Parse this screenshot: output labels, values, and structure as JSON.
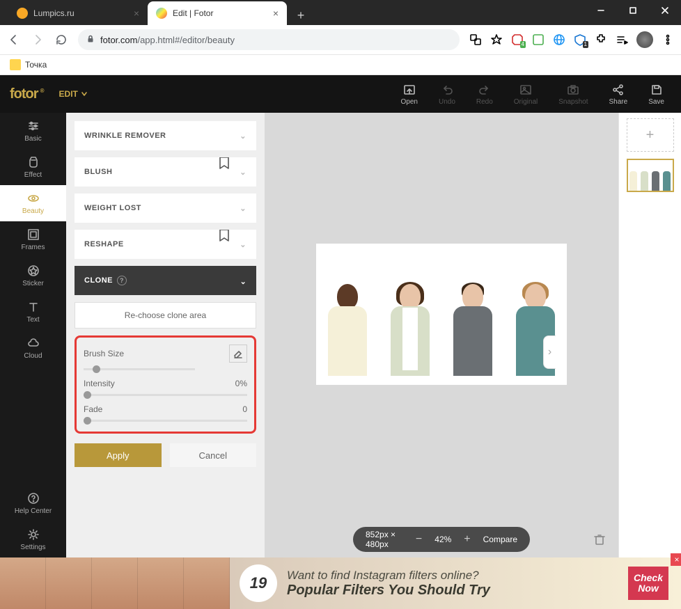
{
  "window": {
    "tabs": [
      {
        "title": "Lumpics.ru",
        "active": false,
        "favicon_color": "#f9a825"
      },
      {
        "title": "Edit | Fotor",
        "active": true,
        "favicon_gradient": true
      }
    ],
    "url_domain": "fotor.com",
    "url_path": "/app.html#/editor/beauty",
    "bookmark": "Точка"
  },
  "extensions": {
    "adblock_count": "4",
    "vault_count": "1"
  },
  "app": {
    "brand": "fotor",
    "mode": "EDIT",
    "toolbar": {
      "open": "Open",
      "undo": "Undo",
      "redo": "Redo",
      "original": "Original",
      "snapshot": "Snapshot",
      "share": "Share",
      "save": "Save"
    },
    "sidebar": {
      "basic": "Basic",
      "effect": "Effect",
      "beauty": "Beauty",
      "frames": "Frames",
      "sticker": "Sticker",
      "text": "Text",
      "cloud": "Cloud",
      "help": "Help Center",
      "settings": "Settings"
    },
    "panel": {
      "wrinkle": "WRINKLE REMOVER",
      "blush": "BLUSH",
      "weight": "WEIGHT LOST",
      "reshape": "RESHAPE",
      "clone": "CLONE",
      "rechoose": "Re-choose clone area",
      "brush_size": "Brush Size",
      "intensity_label": "Intensity",
      "intensity_value": "0%",
      "fade_label": "Fade",
      "fade_value": "0",
      "apply": "Apply",
      "cancel": "Cancel"
    },
    "status": {
      "dimensions": "852px × 480px",
      "zoom": "42%",
      "compare": "Compare"
    }
  },
  "ad": {
    "number": "19",
    "line1": "Want to find Instagram filters online?",
    "line2": "Popular Filters You Should Try",
    "cta1": "Check",
    "cta2": "Now"
  }
}
